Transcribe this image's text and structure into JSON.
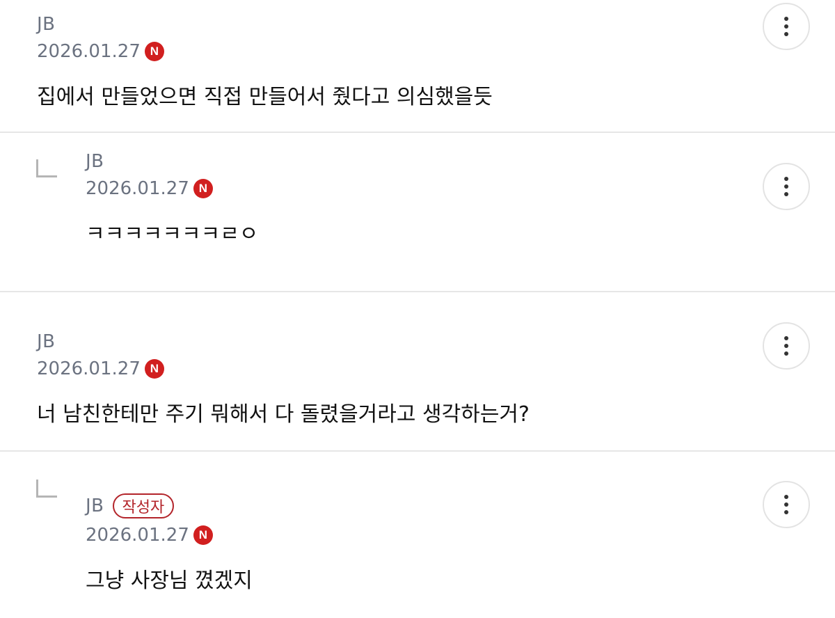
{
  "comments": [
    {
      "author": "JB",
      "date": "2026.01.27",
      "new_badge": "N",
      "text": "집에서 만들었으면 직접 만들어서 줬다고 의심했을듯",
      "is_reply": false
    },
    {
      "author": "JB",
      "date": "2026.01.27",
      "new_badge": "N",
      "text": "ㅋㅋㅋㅋㅋㅋㅋㄹㅇ",
      "is_reply": true
    },
    {
      "author": "JB",
      "date": "2026.01.27",
      "new_badge": "N",
      "text": "너 남친한테만 주기 뭐해서 다 돌렸을거라고 생각하는거?",
      "is_reply": false
    },
    {
      "author": "JB",
      "writer_badge": "작성자",
      "date": "2026.01.27",
      "new_badge": "N",
      "text": "그냥 사장님 꼈겠지",
      "is_reply": true
    }
  ],
  "icons": {
    "more": "more-vertical-icon",
    "reply": "reply-arrow-icon",
    "new": "new-badge-icon"
  },
  "colors": {
    "badge_red": "#d11f1f",
    "writer_red": "#b3242a",
    "meta_gray": "#6b7280",
    "divider": "#e6e6e6"
  }
}
